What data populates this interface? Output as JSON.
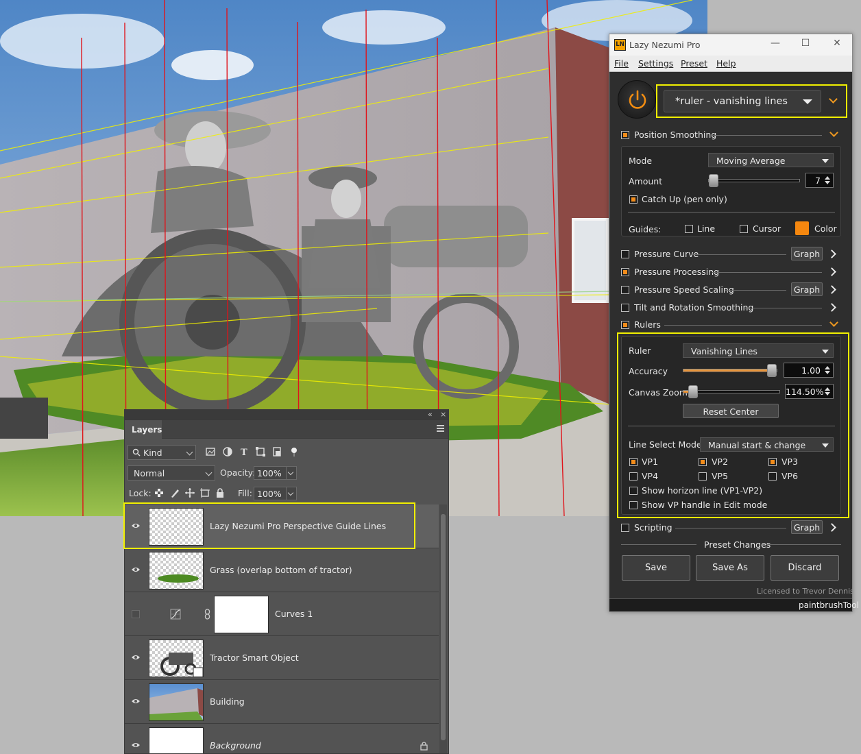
{
  "canvas": {
    "description_icons": [
      "perspective-guide-lines"
    ]
  },
  "layers_panel": {
    "tab": "Layers",
    "filter_kind": "Kind",
    "blend_mode": "Normal",
    "opacity_label": "Opacity:",
    "opacity_value": "100%",
    "lock_label": "Lock:",
    "fill_label": "Fill:",
    "fill_value": "100%",
    "layers": [
      {
        "name": "Lazy Nezumi Pro Perspective Guide Lines",
        "visible": true,
        "selected": true
      },
      {
        "name": "Grass (overlap bottom of tractor)",
        "visible": true
      },
      {
        "name": "Curves 1",
        "visible": false,
        "adjustment": true
      },
      {
        "name": "Tractor Smart Object",
        "visible": true,
        "smart_object": true
      },
      {
        "name": "Building",
        "visible": true
      },
      {
        "name": "Background",
        "visible": true,
        "locked": true
      }
    ]
  },
  "ln": {
    "title": "Lazy Nezumi Pro",
    "menu": [
      "File",
      "Settings",
      "Preset",
      "Help"
    ],
    "preset": "*ruler - vanishing lines",
    "position_smoothing": {
      "label": "Position Smoothing",
      "mode_label": "Mode",
      "mode_value": "Moving Average",
      "amount_label": "Amount",
      "amount_value": "7",
      "amount_level": 0.05,
      "catch_up": "Catch Up (pen only)",
      "guides_label": "Guides:",
      "guide_line": "Line",
      "guide_cursor": "Cursor",
      "guide_color": "Color",
      "guide_color_hex": "#f5870f"
    },
    "sections": [
      {
        "label": "Pressure Curve",
        "checked": false,
        "graph": "Graph"
      },
      {
        "label": "Pressure Processing",
        "checked": true,
        "graph": ""
      },
      {
        "label": "Pressure Speed Scaling",
        "checked": false,
        "graph": "Graph"
      },
      {
        "label": "Tilt and Rotation Smoothing",
        "checked": false,
        "graph": ""
      },
      {
        "label": "Rulers",
        "checked": true,
        "graph": ""
      }
    ],
    "rulers": {
      "ruler_label": "Ruler",
      "ruler_value": "Vanishing Lines",
      "accuracy_label": "Accuracy",
      "accuracy_value": "1.00",
      "accuracy_level": 1.0,
      "zoom_label": "Canvas Zoom",
      "zoom_value": "114.50%",
      "zoom_level": 0.1,
      "reset_center": "Reset Center",
      "line_select_label": "Line Select Mode",
      "line_select_value": "Manual start & change",
      "vps": [
        {
          "label": "VP1",
          "checked": true
        },
        {
          "label": "VP2",
          "checked": true
        },
        {
          "label": "VP3",
          "checked": true
        },
        {
          "label": "VP4",
          "checked": false
        },
        {
          "label": "VP5",
          "checked": false
        },
        {
          "label": "VP6",
          "checked": false
        }
      ],
      "show_horizon": "Show horizon line (VP1-VP2)",
      "show_vp_handle": "Show VP handle in Edit mode"
    },
    "scripting": {
      "label": "Scripting",
      "graph": "Graph"
    },
    "preset_changes": "Preset Changes",
    "save": "Save",
    "save_as": "Save As",
    "discard": "Discard",
    "licensed": "Licensed to Trevor Dennis",
    "status": "paintbrushTool"
  }
}
